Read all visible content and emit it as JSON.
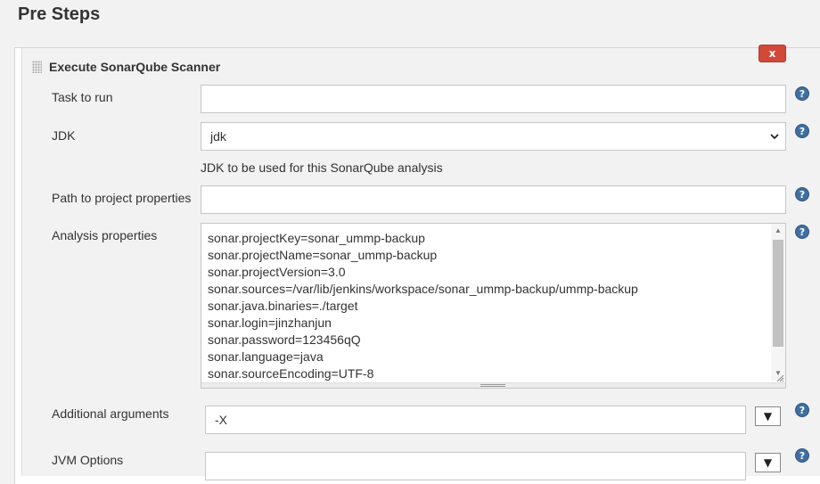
{
  "section": {
    "title": "Pre Steps"
  },
  "step": {
    "title": "Execute SonarQube Scanner",
    "delete_label": "x"
  },
  "fields": {
    "task": {
      "label": "Task to run",
      "value": ""
    },
    "jdk": {
      "label": "JDK",
      "selected": "jdk",
      "hint": "JDK to be used for this SonarQube analysis"
    },
    "path": {
      "label": "Path to project properties",
      "value": ""
    },
    "analysis": {
      "label": "Analysis properties",
      "lines": [
        "sonar.projectKey=sonar_ummp-backup",
        "sonar.projectName=sonar_ummp-backup",
        "sonar.projectVersion=3.0",
        "sonar.sources=/var/lib/jenkins/workspace/sonar_ummp-backup/ummp-backup",
        "sonar.java.binaries=./target",
        "sonar.login=jinzhanjun",
        "sonar.password=123456qQ",
        "sonar.language=java",
        "sonar.sourceEncoding=UTF-8"
      ]
    },
    "additional": {
      "label": "Additional arguments",
      "value": "-X"
    },
    "jvm": {
      "label": "JVM Options",
      "value": ""
    }
  },
  "icons": {
    "help": "?",
    "dropdown": "▼"
  },
  "colors": {
    "delete_button": "#d24939",
    "help_icon": "#3f6fa0"
  }
}
